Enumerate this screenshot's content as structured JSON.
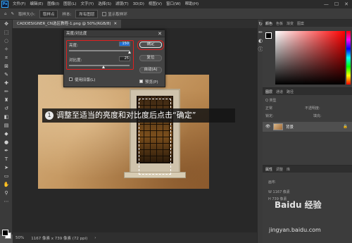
{
  "menubar": {
    "logo": "Ps",
    "items": [
      "文件(F)",
      "编辑(E)",
      "图像(I)",
      "图层(L)",
      "文字(Y)",
      "选择(S)",
      "滤镜(T)",
      "3D(D)",
      "视图(V)",
      "窗口(W)",
      "帮助(H)"
    ],
    "win_min": "—",
    "win_max": "☐",
    "win_close": "✕"
  },
  "options": {
    "sample_size_label": "取样大小:",
    "sample_size_value": "取样点",
    "sample_label": "样本:",
    "sample_value": "所有图层",
    "show_ring_label": "显示取样环"
  },
  "document": {
    "tab_label": "CADDESIGNER_CN选区教程-1.png @ 50%(RGB/8)",
    "tab_close": "✕",
    "zoom": "50%",
    "size_info": "1167 像素 x 739 像素 (72 ppi)"
  },
  "dialog": {
    "title": "亮度/对比度",
    "close": "✕",
    "brightness_label": "亮度:",
    "brightness_value": "150",
    "brightness_level": 1.0,
    "contrast_label": "对比度:",
    "contrast_value": "25",
    "contrast_level": 0.57,
    "ok_label": "确定",
    "reset_label": "复位",
    "auto_label": "自动(A)",
    "legacy_label": "使用旧版(L)",
    "legacy_checked": false,
    "preview_label": "预览(P)",
    "preview_checked": true
  },
  "tip": {
    "number": "1",
    "text": "调整至适当的亮度和对比度后点击“确定”"
  },
  "panels": {
    "color_tabs": [
      "颜色",
      "色板",
      "渐变",
      "图案"
    ],
    "layers_tabs": [
      "图层",
      "通道",
      "路径"
    ],
    "layer_kind": "Q 类型",
    "blend_mode": "正常",
    "opacity_label": "不透明度:",
    "lock_label": "锁定:",
    "fill_label": "填充:",
    "layer_name": "背景",
    "props_tabs": [
      "属性",
      "调整",
      "库"
    ],
    "props_section": "画布",
    "props_w": "W 1167 像素",
    "props_h": "H 739 像素"
  },
  "watermark": {
    "brand": "Baidu 经验",
    "url": "jingyan.baidu.com"
  },
  "colors": {
    "accent_red": "#e02020",
    "highlight_blue": "#1e6fd6"
  }
}
